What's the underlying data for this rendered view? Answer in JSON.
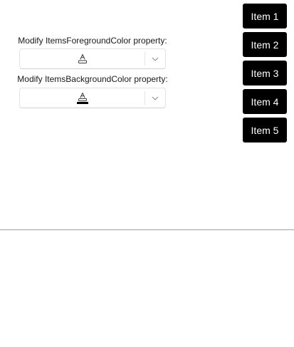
{
  "foreground": {
    "label": "Modify ItemsForegroundColor property:",
    "icon": "font-color-icon"
  },
  "background": {
    "label": "Modify ItemsBackgroundColor property:",
    "icon": "font-color-icon",
    "underline_color": "#000000"
  },
  "items": [
    {
      "label": "Item 1"
    },
    {
      "label": "Item 2"
    },
    {
      "label": "Item 3"
    },
    {
      "label": "Item 4"
    },
    {
      "label": "Item 5"
    }
  ],
  "colors": {
    "item_background": "#000000",
    "item_foreground": "#ffffff",
    "divider": "#a0a0a0"
  }
}
